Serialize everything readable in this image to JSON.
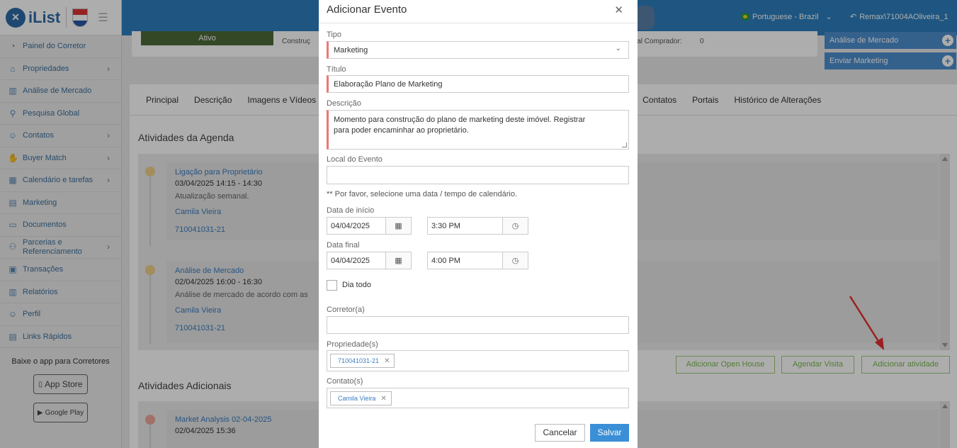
{
  "header": {
    "logo_text": "iList",
    "language": "Portuguese - Brazil",
    "user": "Remax\\71004AOliveira_1"
  },
  "sidebar": {
    "items": [
      {
        "label": "Painel do Corretor",
        "icon": "gauge-icon",
        "chevron": false
      },
      {
        "label": "Propriedades",
        "icon": "home-icon",
        "chevron": true
      },
      {
        "label": "Análise de Mercado",
        "icon": "bar-chart-icon",
        "chevron": false
      },
      {
        "label": "Pesquisa Global",
        "icon": "search-icon",
        "chevron": false
      },
      {
        "label": "Contatos",
        "icon": "contacts-icon",
        "chevron": true
      },
      {
        "label": "Buyer Match",
        "icon": "hand-icon",
        "chevron": true
      },
      {
        "label": "Calendário e tarefas",
        "icon": "calendar-icon",
        "chevron": true
      },
      {
        "label": "Marketing",
        "icon": "marketing-icon",
        "chevron": false
      },
      {
        "label": "Documentos",
        "icon": "folder-icon",
        "chevron": false
      },
      {
        "label": "Parcerias e Referenciamento",
        "icon": "handshake-icon",
        "chevron": true
      },
      {
        "label": "Transações",
        "icon": "briefcase-icon",
        "chevron": false
      },
      {
        "label": "Relatórios",
        "icon": "report-icon",
        "chevron": false
      },
      {
        "label": "Perfil",
        "icon": "user-icon",
        "chevron": false
      },
      {
        "label": "Links Rápidos",
        "icon": "links-icon",
        "chevron": false
      }
    ],
    "app_title": "Baixe o app para Corretores",
    "app_store": "App Store",
    "google_play": "Google Play"
  },
  "property_card": {
    "status": "Ativo",
    "construction_label": "Construç",
    "buyer_label": "cial Comprador:",
    "buyer_value": "0"
  },
  "right_actions": {
    "market_analysis": "Análise de Mercado",
    "send_marketing": "Enviar Marketing"
  },
  "tabs": [
    "Principal",
    "Descrição",
    "Imagens e Vídeos",
    "Contatos",
    "Portais",
    "Histórico de Alterações"
  ],
  "agenda": {
    "title": "Atividades da Agenda",
    "items": [
      {
        "title": "Ligação para Proprietário",
        "date": "03/04/2025 14:15 - 14:30",
        "desc": "Atualização semanal.",
        "contact": "Camila Vieira",
        "property": "710041031-21"
      },
      {
        "title": "Análise de Mercado",
        "date": "02/04/2025 16:00 - 16:30",
        "desc": "Análise de mercado de acordo com as",
        "contact": "Camila Vieira",
        "property": "710041031-21"
      }
    ],
    "buttons": {
      "open_house": "Adicionar Open House",
      "visit": "Agendar Visita",
      "activity": "Adicionar atividade"
    }
  },
  "additional": {
    "title": "Atividades Adicionais",
    "items": [
      {
        "title": "Market Analysis 02-04-2025",
        "date": "02/04/2025 15:36"
      }
    ]
  },
  "modal": {
    "title": "Adicionar Evento",
    "type_label": "Tipo",
    "type_value": "Marketing",
    "title_label": "Título",
    "title_value": "Elaboração Plano de Marketing",
    "desc_label": "Descrição",
    "desc_value": "Momento para construção do plano de marketing deste imóvel. Registrar\npara poder encaminhar ao proprietário.",
    "location_label": "Local do Evento",
    "note": "** Por favor, selecione uma data / tempo de calendário.",
    "start_label": "Data de início",
    "start_date": "04/04/2025",
    "start_time": "3:30 PM",
    "end_label": "Data final",
    "end_date": "04/04/2025",
    "end_time": "4:00 PM",
    "allday_label": "Dia todo",
    "broker_label": "Corretor(a)",
    "properties_label": "Propriedade(s)",
    "property_chip": "710041031-21",
    "contacts_label": "Contato(s)",
    "contact_chip": "Camila Vieira",
    "cancel": "Cancelar",
    "save": "Salvar"
  },
  "colors": {
    "brand_blue": "#2d7fbf",
    "required_marker": "#e77777",
    "save_button": "#3b8fd6",
    "arrow": "#e53030"
  }
}
